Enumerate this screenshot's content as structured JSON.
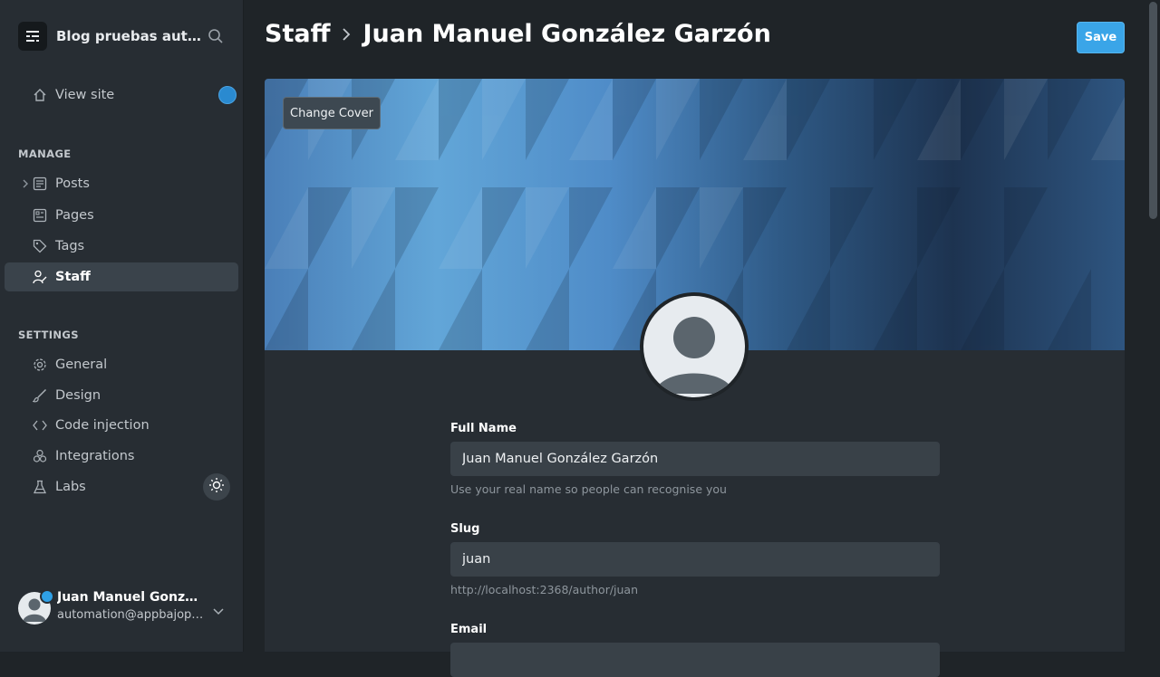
{
  "sidebar": {
    "brand_title": "Blog pruebas auto...",
    "view_site": "View site",
    "manage_label": "MANAGE",
    "manage_items": [
      {
        "label": "Posts",
        "icon": "posts-icon"
      },
      {
        "label": "Pages",
        "icon": "pages-icon"
      },
      {
        "label": "Tags",
        "icon": "tag-icon"
      },
      {
        "label": "Staff",
        "icon": "staff-icon",
        "active": true
      }
    ],
    "settings_label": "SETTINGS",
    "settings_items": [
      {
        "label": "General",
        "icon": "gear-icon"
      },
      {
        "label": "Design",
        "icon": "brush-icon"
      },
      {
        "label": "Code injection",
        "icon": "code-icon"
      },
      {
        "label": "Integrations",
        "icon": "integrations-icon"
      },
      {
        "label": "Labs",
        "icon": "flask-icon"
      }
    ],
    "user": {
      "name": "Juan Manuel Gonzále...",
      "email": "automation@appbajopru..."
    }
  },
  "header": {
    "breadcrumb_root": "Staff",
    "title": "Juan Manuel González Garzón",
    "save_label": "Save"
  },
  "cover": {
    "change_cover_label": "Change Cover"
  },
  "form": {
    "full_name": {
      "label": "Full Name",
      "value": "Juan Manuel González Garzón",
      "hint": "Use your real name so people can recognise you"
    },
    "slug": {
      "label": "Slug",
      "value": "juan",
      "hint": "http://localhost:2368/author/juan"
    },
    "email": {
      "label": "Email"
    }
  },
  "colors": {
    "accent": "#3aa5e8",
    "sidebar_bg": "#272d33",
    "page_bg": "#1f2428"
  }
}
